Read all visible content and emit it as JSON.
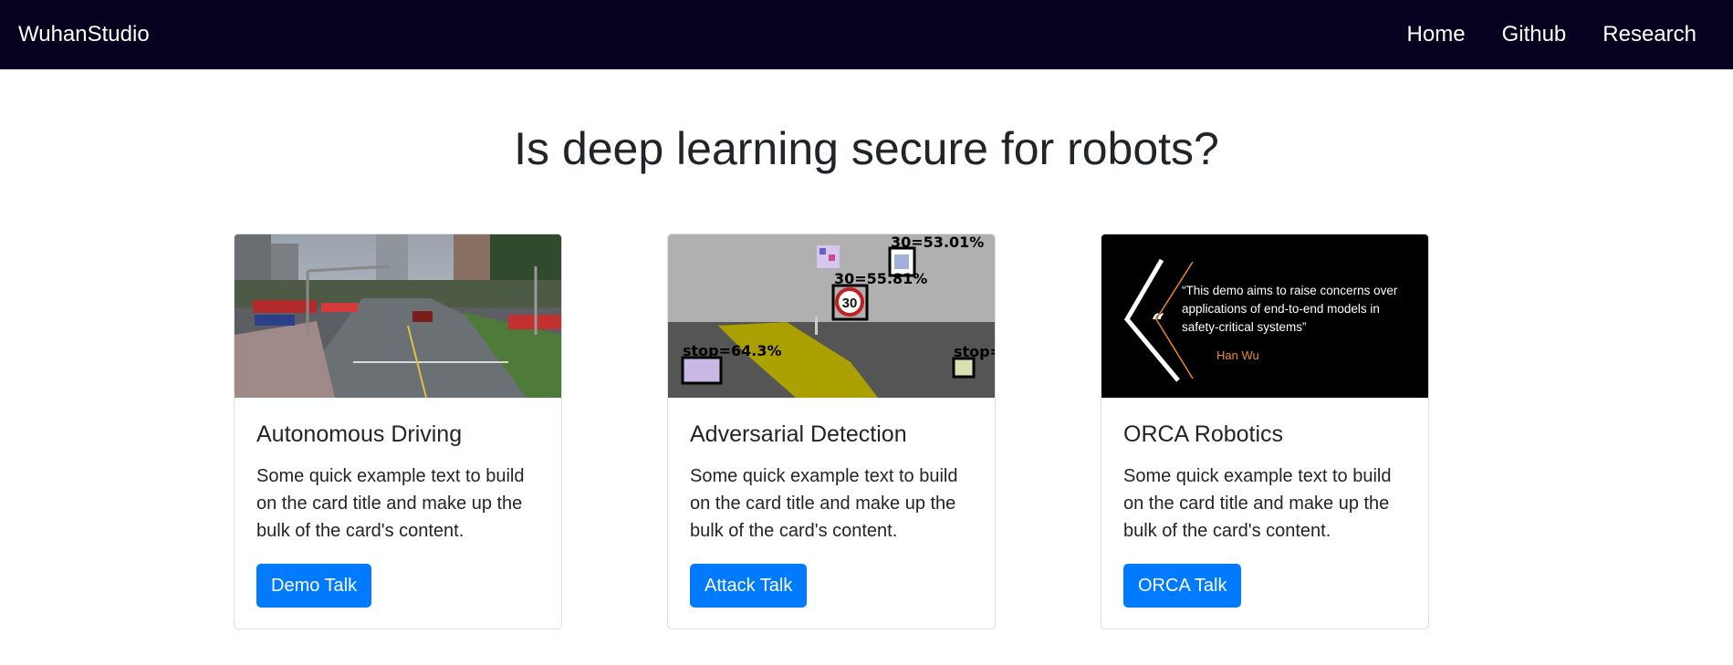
{
  "navbar": {
    "brand": "WuhanStudio",
    "links": [
      "Home",
      "Github",
      "Research"
    ],
    "background": "#05021f"
  },
  "headline": "Is deep learning secure for robots?",
  "cards": [
    {
      "title": "Autonomous Driving",
      "text": "Some quick example text to build on the card title and make up the bulk of the card's content.",
      "button": "Demo Talk",
      "image": {}
    },
    {
      "title": "Adversarial Detection",
      "text": "Some quick example text to build on the card title and make up the bulk of the card's content.",
      "button": "Attack Talk",
      "image": {
        "labels": [
          "30=53.01%",
          "30=55.81%",
          "stop=64.3%",
          "stop="
        ],
        "sign": "30"
      }
    },
    {
      "title": "ORCA Robotics",
      "text": "Some quick example text to build on the card title and make up the bulk of the card's content.",
      "button": "ORCA Talk",
      "image": {
        "quote_lines": [
          "“This demo aims to raise concerns over",
          "applications of end-to-end models in",
          "safety-critical systems”"
        ],
        "quote_mark": "“",
        "author": "Han Wu"
      }
    }
  ],
  "colors": {
    "primary": "#007bff",
    "accent_orange": "#e8892a"
  }
}
